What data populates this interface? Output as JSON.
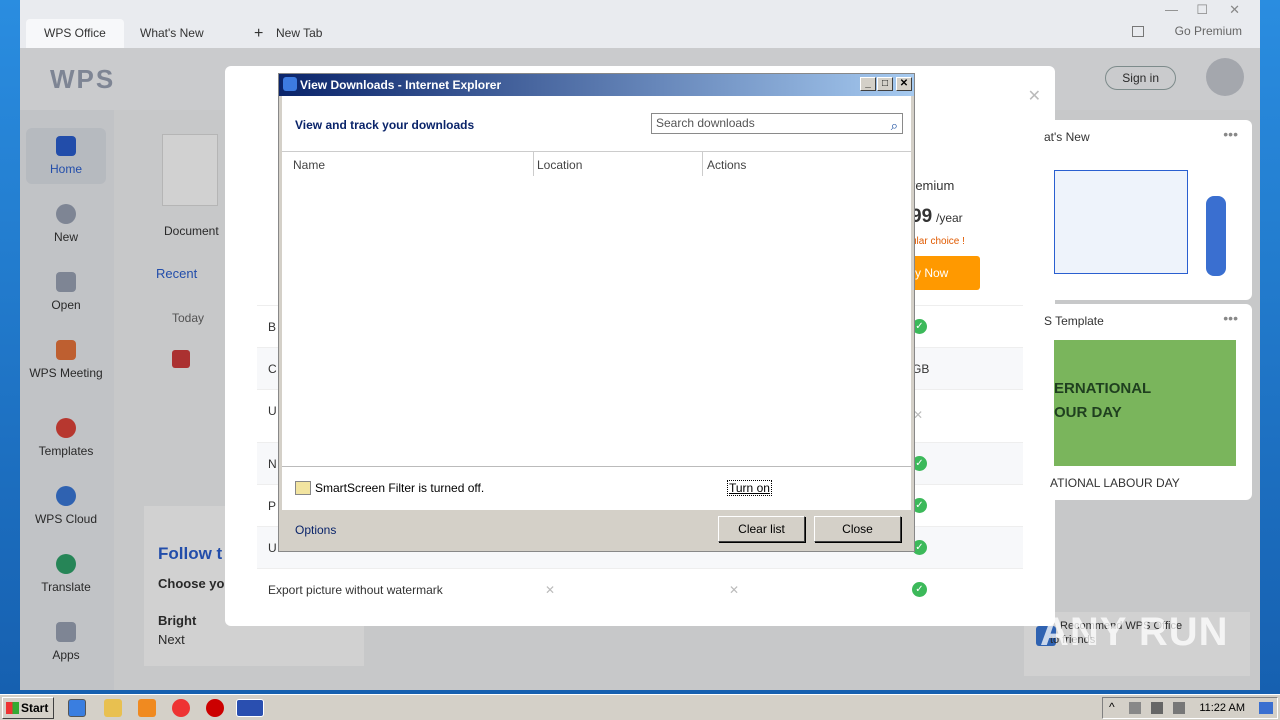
{
  "wps": {
    "tabs": [
      {
        "label": "WPS Office"
      },
      {
        "label": "What's New"
      },
      {
        "label": "New Tab"
      }
    ],
    "go_premium": "Go Premium",
    "logo": "WPS",
    "signin": "Sign in",
    "sidebar": [
      {
        "label": "Home"
      },
      {
        "label": "New"
      },
      {
        "label": "Open"
      },
      {
        "label": "WPS Meeting"
      },
      {
        "label": "Templates"
      },
      {
        "label": "WPS Cloud"
      },
      {
        "label": "Translate"
      },
      {
        "label": "Apps"
      }
    ],
    "document_label": "Document",
    "recent_tab": "Recent",
    "today": "Today",
    "follow_title": "Follow t",
    "choose": "Choose yo",
    "bright": "Bright",
    "next": "Next"
  },
  "modal": {
    "premium_label": "remium",
    "price": "99",
    "per_year": "/year",
    "popular": "ular choice !",
    "buy_now": "y Now",
    "rows": [
      {
        "label": "B"
      },
      {
        "label": "C",
        "right": "GB"
      },
      {
        "label": "U"
      },
      {
        "label": "N"
      },
      {
        "label": "P"
      },
      {
        "label": "U"
      },
      {
        "label": "Export picture without watermark"
      }
    ]
  },
  "right_panel": {
    "whats_new": "at's New",
    "template_title": "S Template",
    "labour_day": "ATIONAL LABOUR DAY",
    "banner_line1": "ERNATIONAL",
    "banner_line2": "OUR DAY",
    "recommend": "Recommend WPS Office",
    "to_friends": "to friends"
  },
  "ie_dialog": {
    "title": "View Downloads - Internet Explorer",
    "heading": "View and track your downloads",
    "search_placeholder": "Search downloads",
    "columns": [
      "Name",
      "Location",
      "Actions"
    ],
    "smartscreen_text": "SmartScreen Filter is turned off.",
    "turn_on": "Turn on",
    "options": "Options",
    "clear_list": "Clear list",
    "close": "Close"
  },
  "taskbar": {
    "start": "Start",
    "clock": "11:22 AM"
  },
  "watermark": "ANY RUN"
}
